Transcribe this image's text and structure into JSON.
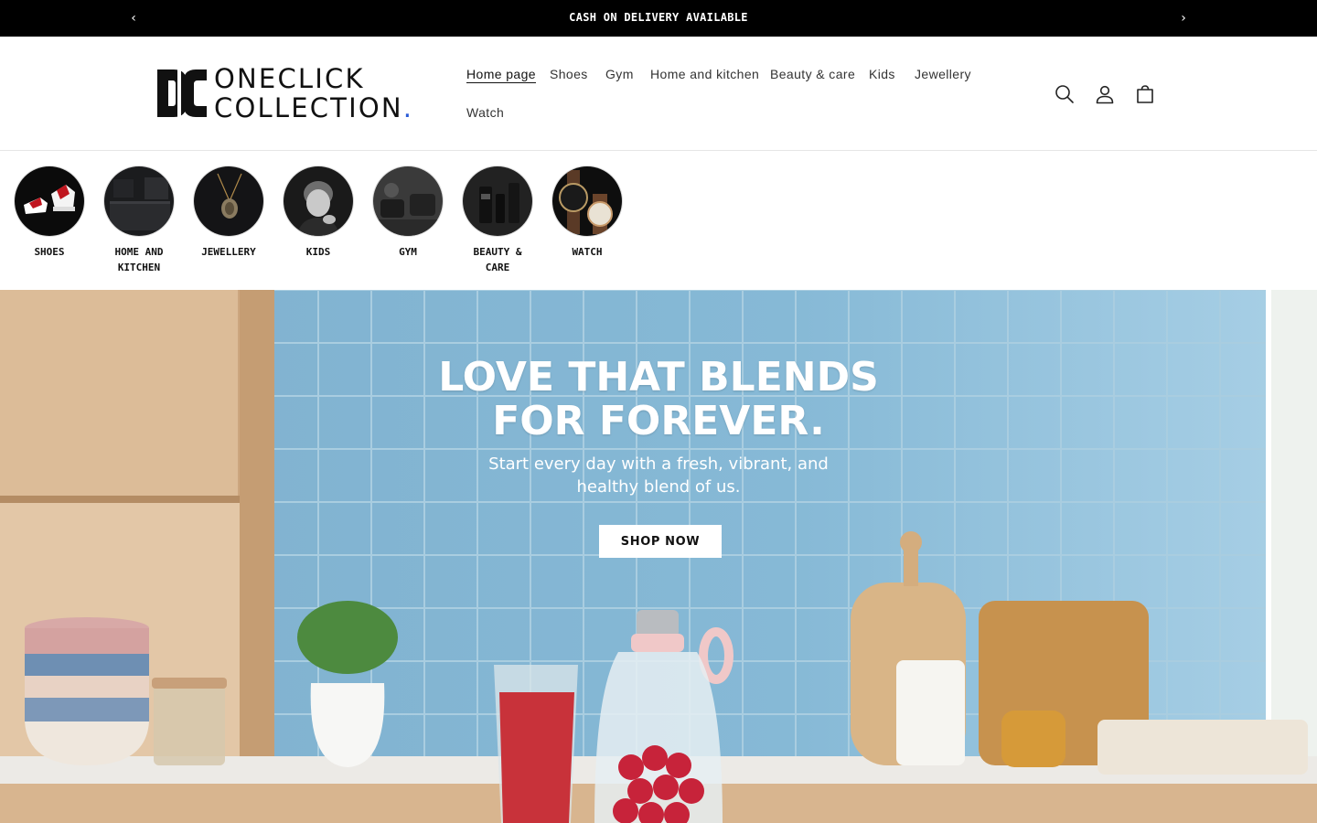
{
  "announcement": {
    "message": "CASH ON DELIVERY AVAILABLE",
    "prev_icon": "chevron-left-icon",
    "next_icon": "chevron-right-icon",
    "prev_glyph": "‹",
    "next_glyph": "›"
  },
  "brand": {
    "line1": "ONECLICK",
    "line2": "COLLECTION",
    "dot": ".",
    "accent_color": "#2a5bd7"
  },
  "nav": {
    "items": [
      {
        "label": "Home page"
      },
      {
        "label": "Shoes"
      },
      {
        "label": "Gym"
      },
      {
        "label": "Home and kitchen"
      },
      {
        "label": "Beauty & care"
      },
      {
        "label": "Kids"
      },
      {
        "label": "Jewellery"
      },
      {
        "label": "Watch"
      }
    ]
  },
  "header_icons": {
    "search": "search-icon",
    "account": "account-icon",
    "cart": "cart-icon"
  },
  "categories": [
    {
      "label": "SHOES"
    },
    {
      "label": "HOME AND KITCHEN"
    },
    {
      "label": "JEWELLERY"
    },
    {
      "label": "KIDS"
    },
    {
      "label": "GYM"
    },
    {
      "label": "BEAUTY & CARE"
    },
    {
      "label": "WATCH"
    }
  ],
  "hero": {
    "headline_line1": "LOVE THAT BLENDS",
    "headline_line2": "FOR FOREVER.",
    "sub_line1": "Start every day with a fresh, vibrant, and",
    "sub_line2": "healthy blend of us.",
    "cta": "SHOP NOW"
  }
}
